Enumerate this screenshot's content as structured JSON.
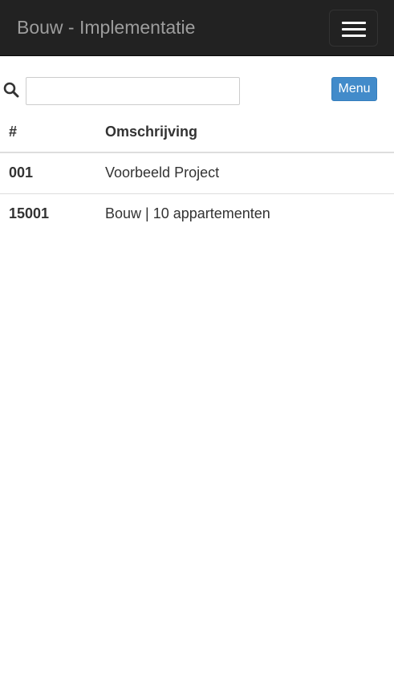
{
  "navbar": {
    "brand": "Bouw - Implementatie",
    "toggle_icon": "hamburger-menu-icon"
  },
  "toolbar": {
    "search_icon": "search-icon",
    "search_value": "",
    "search_placeholder": "",
    "menu_label": "Menu",
    "menu_color": "#428bca"
  },
  "table": {
    "headers": [
      "#",
      "Omschrijving"
    ],
    "rows": [
      {
        "number": "001",
        "description": "Voorbeeld Project"
      },
      {
        "number": "15001",
        "description": "Bouw | 10 appartementen"
      }
    ]
  }
}
